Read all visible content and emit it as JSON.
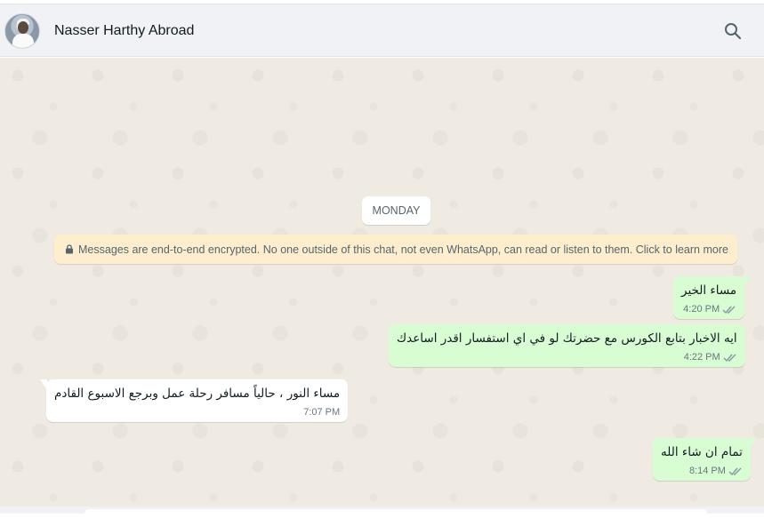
{
  "header": {
    "contact_name": "Nasser Harthy Abroad",
    "search_icon": "search-icon",
    "avatar_icon": "avatar"
  },
  "chat": {
    "day_divider": "MONDAY",
    "encryption_notice": "Messages are end-to-end encrypted. No one outside of this chat, not even WhatsApp, can read or listen to them. Click to learn more",
    "messages": [
      {
        "direction": "outgoing",
        "text": "مساء الخير",
        "time": "4:20 PM",
        "status": "read"
      },
      {
        "direction": "outgoing",
        "text": "ايه الاخبار بتابع الكورس مع حضرتك لو في اي استفسار اقدر اساعدك",
        "time": "4:22 PM",
        "status": "read"
      },
      {
        "direction": "incoming",
        "text": "مساء النور ، حالياً مسافر رحلة عمل وبرجع الاسبوع القادم",
        "time": "7:07 PM"
      },
      {
        "direction": "outgoing",
        "text": "تمام ان شاء الله",
        "time": "8:14 PM",
        "status": "read"
      }
    ]
  },
  "colors": {
    "outgoing_bubble": "#d9fdd3",
    "incoming_bubble": "#ffffff",
    "chat_background": "#efeae2",
    "header_background": "#f0f2f5",
    "notice_background": "#ffeecd",
    "read_ticks": "#8696a0"
  }
}
